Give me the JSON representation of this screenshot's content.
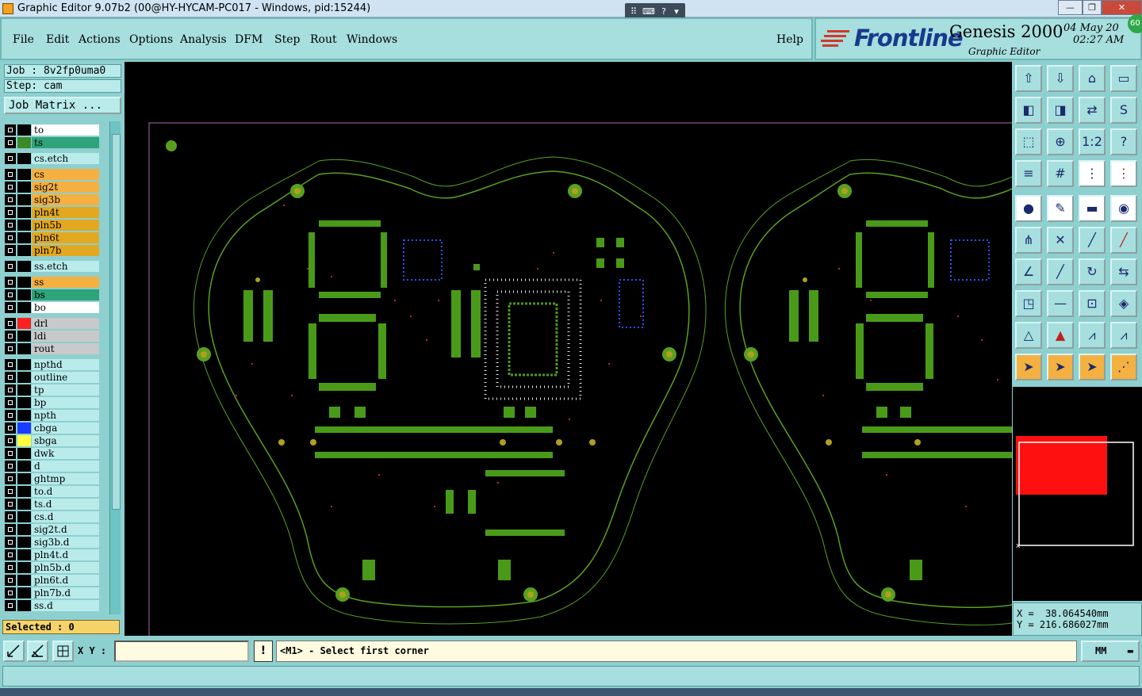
{
  "window": {
    "title": "Graphic Editor 9.07b2 (00@HY-HYCAM-PC017 - Windows, pid:15244)",
    "controls": [
      "—",
      "❐",
      "✕"
    ]
  },
  "menu": {
    "items": [
      "File",
      "Edit",
      "Actions",
      "Options",
      "Analysis",
      "DFM",
      "Step",
      "Rout",
      "Windows"
    ],
    "help": "Help"
  },
  "brand": {
    "logo": "Frontline",
    "product": "Genesis 2000",
    "subtitle": "Graphic Editor",
    "date": "04 May 20",
    "time": "02:27 AM",
    "badge": "60"
  },
  "job": {
    "job_label": "Job : 8v2fp0uma0",
    "step_label": "Step: cam",
    "matrix_button": "Job Matrix ..."
  },
  "layers": [
    {
      "name": "to",
      "bg": "#ffffff",
      "swatch": "#000000"
    },
    {
      "name": "ts",
      "bg": "#2fa37a",
      "swatch": "#3a8a2a"
    },
    {
      "name": "cs.etch",
      "bg": "#b9ebeb",
      "swatch": "#000000"
    },
    {
      "name": "cs",
      "bg": "#f4b040",
      "swatch": "#000000"
    },
    {
      "name": "sig2t",
      "bg": "#f4b040",
      "swatch": "#000000"
    },
    {
      "name": "sig3b",
      "bg": "#f4b040",
      "swatch": "#000000"
    },
    {
      "name": "pln4t",
      "bg": "#e3a820",
      "swatch": "#000000"
    },
    {
      "name": "pln5b",
      "bg": "#e3a820",
      "swatch": "#000000"
    },
    {
      "name": "pln6t",
      "bg": "#e3a820",
      "swatch": "#000000"
    },
    {
      "name": "pln7b",
      "bg": "#e3a820",
      "swatch": "#000000"
    },
    {
      "name": "ss.etch",
      "bg": "#b9ebeb",
      "swatch": "#000000"
    },
    {
      "name": "ss",
      "bg": "#f4b040",
      "swatch": "#000000"
    },
    {
      "name": "bs",
      "bg": "#2fa37a",
      "swatch": "#000000"
    },
    {
      "name": "bo",
      "bg": "#ffffff",
      "swatch": "#000000"
    },
    {
      "name": "drl",
      "bg": "#c9c9c9",
      "swatch": "#ff2020"
    },
    {
      "name": "ldi",
      "bg": "#c9c9c9",
      "swatch": "#000000"
    },
    {
      "name": "rout",
      "bg": "#c9c9c9",
      "swatch": "#000000"
    },
    {
      "name": "npthd",
      "bg": "#b9ebeb",
      "swatch": "#000000"
    },
    {
      "name": "outline",
      "bg": "#b9ebeb",
      "swatch": "#000000"
    },
    {
      "name": "tp",
      "bg": "#b9ebeb",
      "swatch": "#000000"
    },
    {
      "name": "bp",
      "bg": "#b9ebeb",
      "swatch": "#000000"
    },
    {
      "name": "npth",
      "bg": "#b9ebeb",
      "swatch": "#000000"
    },
    {
      "name": "cbga",
      "bg": "#b9ebeb",
      "swatch": "#1a3cff"
    },
    {
      "name": "sbga",
      "bg": "#b9ebeb",
      "swatch": "#ffff40"
    },
    {
      "name": "dwk",
      "bg": "#b9ebeb",
      "swatch": "#000000"
    },
    {
      "name": "d",
      "bg": "#b9ebeb",
      "swatch": "#000000"
    },
    {
      "name": "ghtmp",
      "bg": "#b9ebeb",
      "swatch": "#000000"
    },
    {
      "name": "to.d",
      "bg": "#b9ebeb",
      "swatch": "#000000"
    },
    {
      "name": "ts.d",
      "bg": "#b9ebeb",
      "swatch": "#000000"
    },
    {
      "name": "cs.d",
      "bg": "#b9ebeb",
      "swatch": "#000000"
    },
    {
      "name": "sig2t.d",
      "bg": "#b9ebeb",
      "swatch": "#000000"
    },
    {
      "name": "sig3b.d",
      "bg": "#b9ebeb",
      "swatch": "#000000"
    },
    {
      "name": "pln4t.d",
      "bg": "#b9ebeb",
      "swatch": "#000000"
    },
    {
      "name": "pln5b.d",
      "bg": "#b9ebeb",
      "swatch": "#000000"
    },
    {
      "name": "pln6t.d",
      "bg": "#b9ebeb",
      "swatch": "#000000"
    },
    {
      "name": "pln7b.d",
      "bg": "#b9ebeb",
      "swatch": "#000000"
    },
    {
      "name": "ss.d",
      "bg": "#b9ebeb",
      "swatch": "#000000"
    }
  ],
  "selected_label": "Selected : 0",
  "coords": {
    "x": "X =  38.064540mm",
    "y": "Y = 216.686027mm"
  },
  "status": {
    "xy_label": "X Y :",
    "xy_value": "",
    "warn": "!",
    "prompt": "<M1> - Select first corner",
    "unit": "MM"
  },
  "tools": {
    "rows": [
      [
        "upload-icon",
        "download-icon",
        "home-icon",
        "panel-icon"
      ],
      [
        "move-left-icon",
        "move-right-icon",
        "swap-icon",
        "s-curve-icon"
      ],
      [
        "fit-icon",
        "zoom-center-icon",
        "scale-1-2-icon",
        "help-icon"
      ],
      [
        "settings-icon",
        "grid-icon",
        "network-icon",
        "network-red-icon"
      ],
      [
        "snap-icon",
        "pencil-icon",
        "ruler-icon",
        "dot-icon"
      ],
      [
        "connect-icon",
        "cross-icon",
        "line-node-icon",
        "line-node-red-icon"
      ],
      [
        "angle-icon",
        "diag-line-icon",
        "rotate-icon",
        "mirror-icon"
      ],
      [
        "node-box-icon",
        "horizontal-icon",
        "align-icon",
        "shapes-icon"
      ],
      [
        "triangle-icon",
        "triangle-red-icon",
        "arch-icon",
        "arch-line-icon"
      ],
      [
        "pointer-icon",
        "pointer-box-icon",
        "pointer-circle-icon",
        "pointer-tree-icon"
      ]
    ]
  }
}
